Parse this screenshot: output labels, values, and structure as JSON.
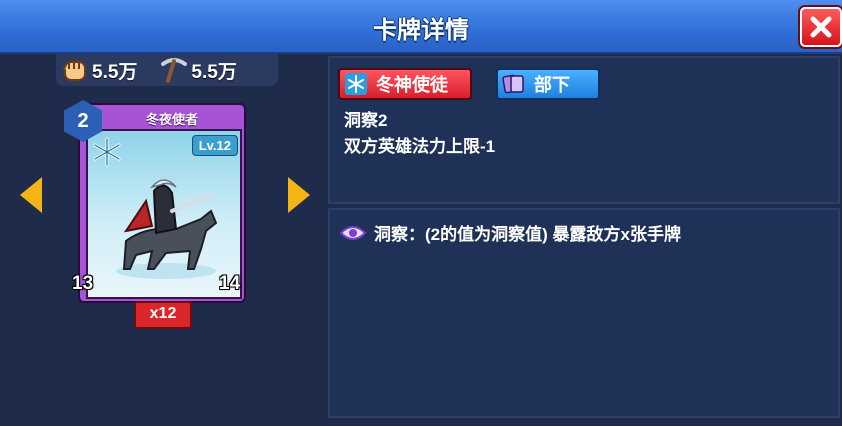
{
  "window": {
    "title": "卡牌详情"
  },
  "stats": {
    "power": "5.5万",
    "mining": "5.5万"
  },
  "card": {
    "name": "冬夜使者",
    "level": "Lv.12",
    "cost": "2",
    "attack": "13",
    "health": "14",
    "count": "x12"
  },
  "tags": {
    "faction": "冬神使徒",
    "type": "部下"
  },
  "description": {
    "line1": "洞察2",
    "line2": "双方英雄法力上限-1"
  },
  "ability": {
    "text": "洞察：(2的值为洞察值) 暴露敌方x张手牌"
  },
  "colors": {
    "title_bar": "#2f6fd8",
    "card_frame": "#a653d6",
    "faction_tag": "#d81f2c",
    "type_tag": "#1f7fe0",
    "arrow": "#f3b414"
  }
}
